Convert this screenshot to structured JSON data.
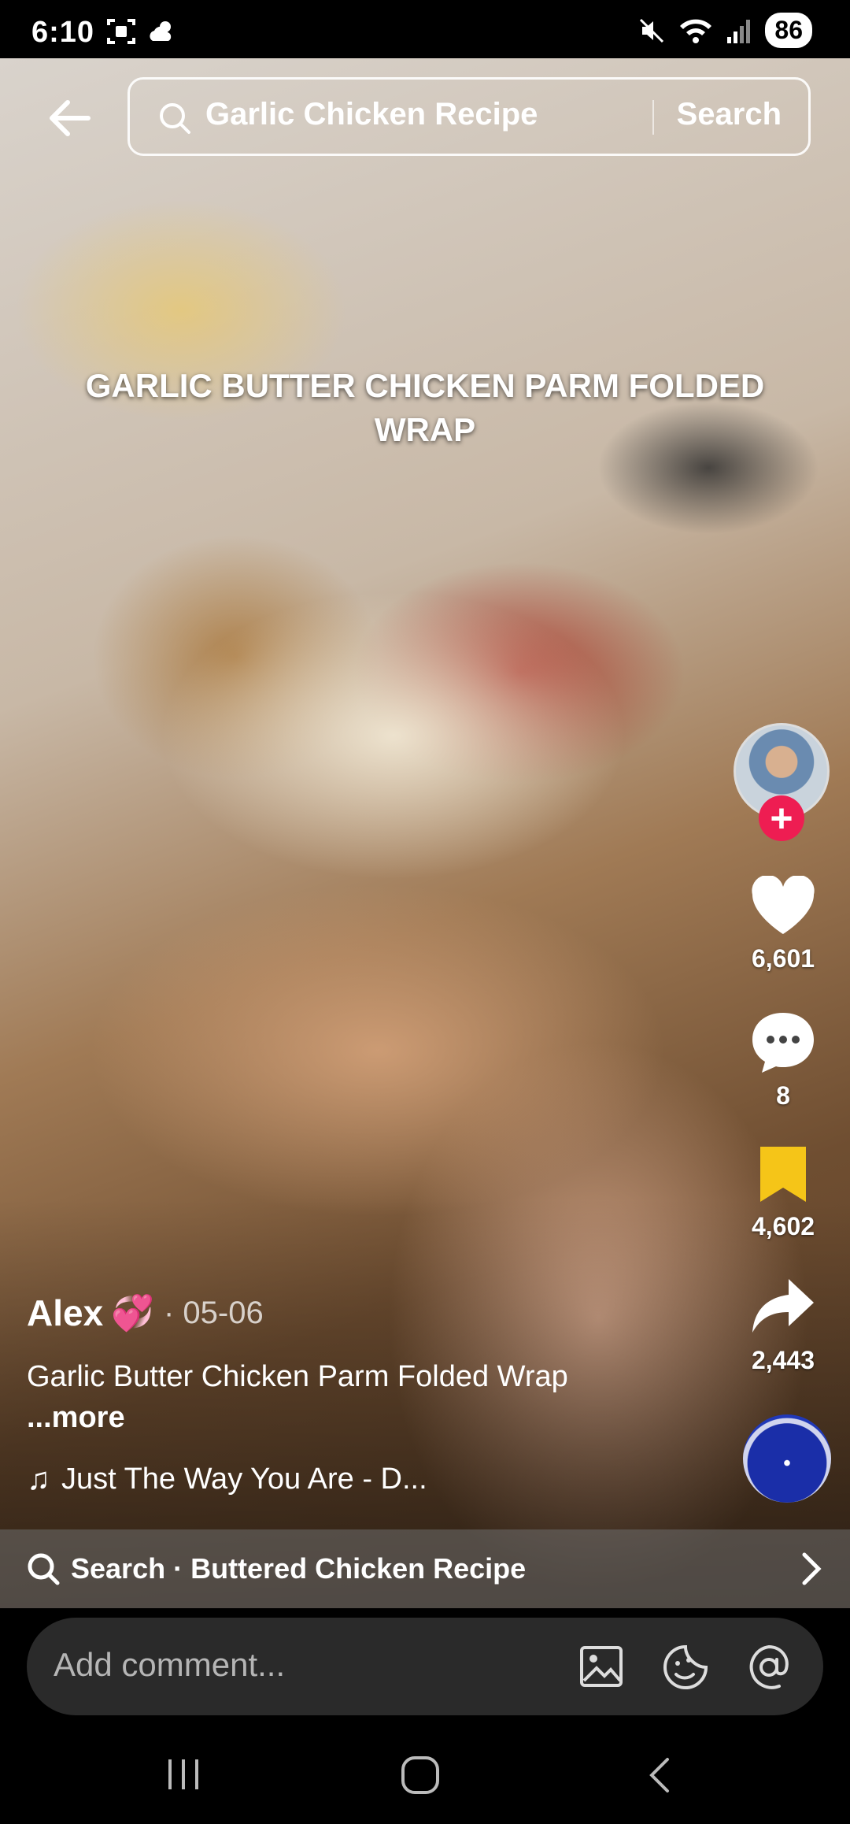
{
  "status": {
    "time": "6:10",
    "battery": "86"
  },
  "search": {
    "query": "Garlic Chicken Recipe",
    "button_label": "Search"
  },
  "video": {
    "caption": "GARLIC BUTTER CHICKEN PARM FOLDED WRAP"
  },
  "actions": {
    "likes": "6,601",
    "comments": "8",
    "saves": "4,602",
    "shares": "2,443",
    "follow_label": "+"
  },
  "post": {
    "username": "Alex",
    "emoji": "💞",
    "date": "· 05-06",
    "description": "Garlic Butter Chicken Parm Folded Wrap",
    "more_label": "...more",
    "music": "Just The Way You Are - D..."
  },
  "related_search": {
    "label": "Search · Buttered Chicken Recipe"
  },
  "comment": {
    "placeholder": "Add comment..."
  },
  "colors": {
    "like_icon": "#ffffff",
    "save_icon": "#f5c518",
    "follow_button": "#ee1d52"
  }
}
